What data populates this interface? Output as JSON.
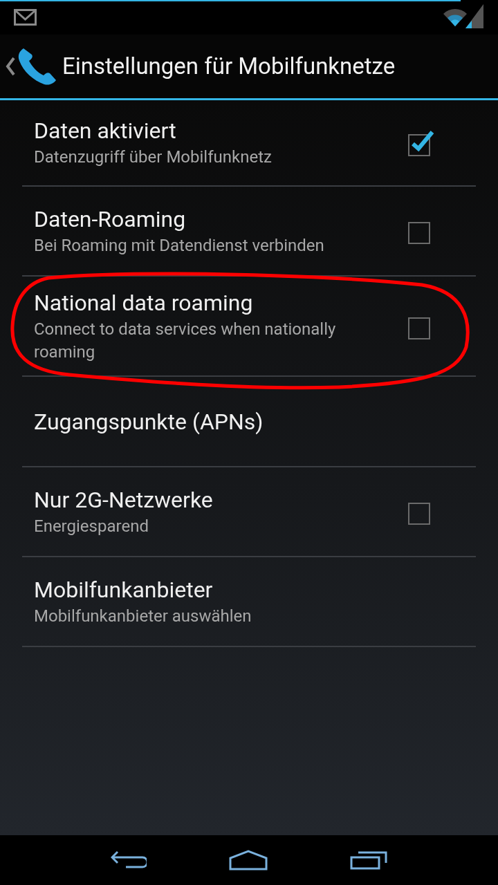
{
  "action_bar": {
    "title": "Einstellungen für Mobilfunknetze"
  },
  "settings": [
    {
      "kind": "checkbox",
      "title": "Daten aktiviert",
      "summary": "Datenzugriff über Mobilfunknetz",
      "checked": true,
      "highlighted": false
    },
    {
      "kind": "checkbox",
      "title": "Daten-Roaming",
      "summary": "Bei Roaming mit Datendienst verbinden",
      "checked": false,
      "highlighted": false
    },
    {
      "kind": "checkbox",
      "title": "National data roaming",
      "summary": "Connect to data services when nationally roaming",
      "checked": false,
      "highlighted": true
    },
    {
      "kind": "link",
      "title": "Zugangspunkte (APNs)",
      "highlighted": false
    },
    {
      "kind": "checkbox",
      "title": "Nur 2G-Netzwerke",
      "summary": "Energiesparend",
      "checked": false,
      "highlighted": false
    },
    {
      "kind": "link",
      "title": "Mobilfunkanbieter",
      "summary": "Mobilfunkanbieter auswählen",
      "highlighted": false
    }
  ]
}
